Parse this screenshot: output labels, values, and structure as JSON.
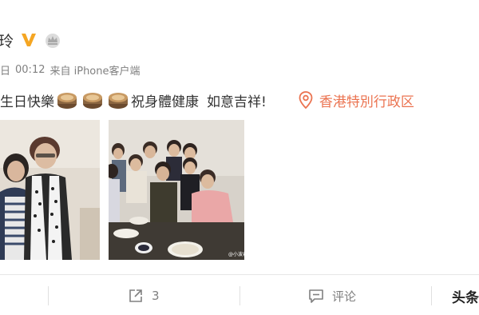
{
  "author": {
    "name": "玲",
    "badges": [
      "vip-v-icon",
      "crown-icon"
    ]
  },
  "meta": {
    "date": "日",
    "time": "00:12",
    "source": "来自 iPhone客户端"
  },
  "post": {
    "text_before": "生日快樂",
    "cake_icons": [
      "cake-icon",
      "cake-icon",
      "cake-icon"
    ],
    "text_after": "祝身體健康",
    "text_tail": "如意吉祥!",
    "location": "香港特別行政区"
  },
  "photos": [
    {
      "name": "photo-two-women"
    },
    {
      "name": "photo-group-dinner",
      "watermark": "@小波君"
    }
  ],
  "actions": {
    "share_count": "3",
    "comment_label": "评论",
    "toutiao_label": "头条"
  },
  "colors": {
    "location": "#eb7350",
    "vip": "#f5a623",
    "meta": "#808080"
  }
}
